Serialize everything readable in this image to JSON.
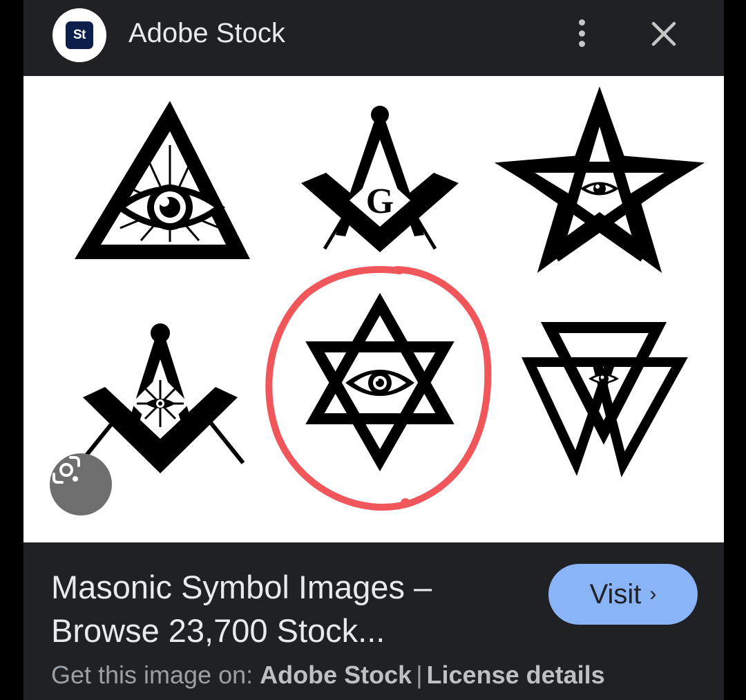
{
  "header": {
    "logo_text": "St",
    "site_name": "Adobe Stock",
    "more_icon": "more-vert-icon",
    "close_icon": "close-icon"
  },
  "image": {
    "symbols": [
      "all-seeing-eye-triangle",
      "square-and-compass-g",
      "pentagram-eye",
      "square-and-compass-eye",
      "hexagram-eye",
      "double-inverted-triangle-eye"
    ],
    "annotation_color": "#f0565a",
    "lens_icon": "google-lens-icon"
  },
  "result": {
    "title": "Masonic Symbol Images – Browse 23,700 Stock...",
    "visit_label": "Visit",
    "visit_chevron": "›",
    "visit_color": "#8ab4f8"
  },
  "footer": {
    "prefix": "Get this image on: ",
    "source": "Adobe Stock",
    "separator": "|",
    "license": "License details"
  }
}
